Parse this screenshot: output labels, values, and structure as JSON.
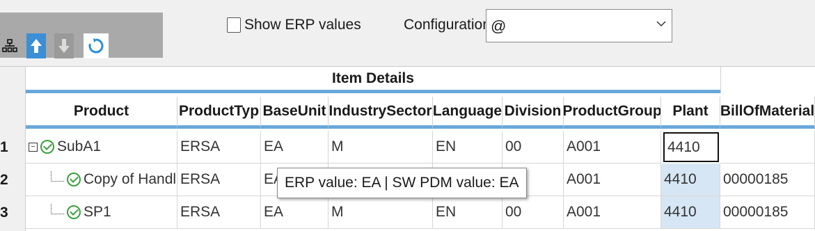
{
  "toolbar": {
    "buttons": [
      {
        "icon": "tree-structure-icon"
      },
      {
        "icon": "arrow-up-icon"
      },
      {
        "icon": "arrow-down-icon"
      },
      {
        "icon": "refresh-icon"
      }
    ],
    "show_erp_label": "Show ERP values",
    "show_erp_checked": false,
    "configuration_label": "Configuration",
    "configuration_value": "@"
  },
  "grid": {
    "group_header": "Item Details",
    "columns": [
      "Product",
      "ProductTyp",
      "BaseUnit",
      "IndustrySector",
      "Language",
      "Division",
      "ProductGroup",
      "Plant",
      "BillOfMaterial"
    ],
    "rows": [
      {
        "num": "1",
        "product": "SubA1",
        "product_type": "ERSA",
        "base_unit": "EA",
        "industry_sector": "M",
        "language": "EN",
        "division": "00",
        "product_group": "A001",
        "plant": "4410",
        "bom": ""
      },
      {
        "num": "2",
        "product": "Copy of Handl",
        "product_type": "ERSA",
        "base_unit": "EA",
        "industry_sector": "",
        "language": "",
        "division": "00",
        "product_group": "A001",
        "plant": "4410",
        "bom": "00000185"
      },
      {
        "num": "3",
        "product": "SP1",
        "product_type": "ERSA",
        "base_unit": "EA",
        "industry_sector": "M",
        "language": "EN",
        "division": "00",
        "product_group": "A001",
        "plant": "4410",
        "bom": "00000185"
      }
    ]
  },
  "tooltip": {
    "text": "ERP value: EA | SW PDM value: EA"
  },
  "colors": {
    "header_underline": "#6aa8da",
    "selected_cell": "#d6e6f4",
    "check_green": "#3aa03a",
    "up_button": "#3a8fd6"
  }
}
